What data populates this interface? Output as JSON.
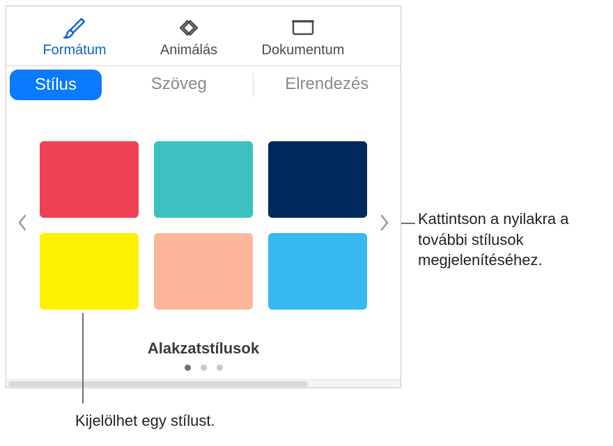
{
  "toolbar": {
    "format": "Formátum",
    "animate": "Animálás",
    "document": "Dokumentum"
  },
  "tabs": {
    "style": "Stílus",
    "text": "Szöveg",
    "layout": "Elrendezés"
  },
  "styles": {
    "caption": "Alakzatstílusok",
    "swatches": [
      {
        "name": "red",
        "color": "#ef4056"
      },
      {
        "name": "teal",
        "color": "#3dc1c0"
      },
      {
        "name": "navy",
        "color": "#002a5c"
      },
      {
        "name": "yellow",
        "color": "#fff200"
      },
      {
        "name": "peach",
        "color": "#fcb79a"
      },
      {
        "name": "sky",
        "color": "#36b8f0"
      }
    ],
    "page_count": 3,
    "active_page": 0
  },
  "callouts": {
    "arrows": "Kattintson a nyilakra a további stílusok megjelenítéséhez.",
    "select": "Kijelölhet egy stílust."
  }
}
